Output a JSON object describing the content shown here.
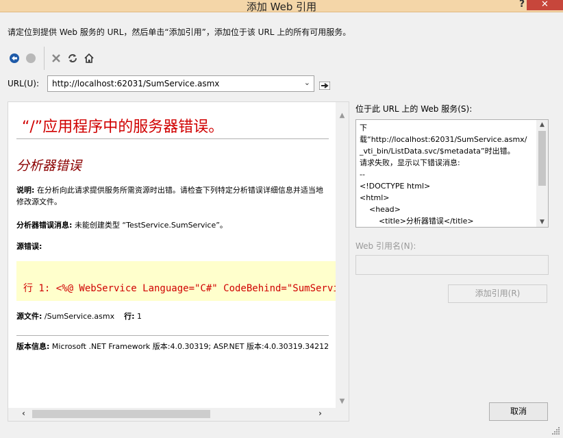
{
  "window": {
    "title": "添加 Web 引用",
    "help": "?",
    "close": "✕"
  },
  "instruction": "请定位到提供 Web 服务的 URL，然后单击“添加引用”，添加位于该 URL 上的所有可用服务。",
  "toolbar": {
    "back_icon": "back-arrow-icon",
    "stop_icon": "stop-icon",
    "delete_icon": "x-icon",
    "refresh_icon": "refresh-icon",
    "home_icon": "home-icon"
  },
  "url": {
    "label": "URL(U):",
    "value": "http://localhost:62031/SumService.asmx",
    "dropdown": "⌄"
  },
  "error_page": {
    "title": "“/”应用程序中的服务器错误。",
    "subtitle": "分析器错误",
    "desc_label": "说明:",
    "desc_text": " 在分析向此请求提供服务所需资源时出错。请检查下列特定分析错误详细信息并适当地修改源文件。",
    "msg_label": "分析器错误消息:",
    "msg_text": " 未能创建类型 “TestService.SumService”。",
    "src_label": "源错误:",
    "code": "行 1:  <%@ WebService Language=\"C#\" CodeBehind=\"SumServic",
    "file_label": "源文件:",
    "file_text": " /SumService.asmx",
    "line_label": "行:",
    "line_text": " 1",
    "version_label": "版本信息:",
    "version_text": " Microsoft .NET Framework 版本:4.0.30319; ASP.NET 版本:4.0.30319.34212"
  },
  "services": {
    "label": "位于此 URL 上的 Web 服务(S):",
    "text": "下\n载“http://localhost:62031/SumService.asmx/\n_vti_bin/ListData.svc/$metadata”时出错。\n请求失败，显示以下错误消息:\n--\n<!DOCTYPE html>\n<html>\n    <head>\n        <title>分析器错误</title>"
  },
  "reference": {
    "label": "Web 引用名(N):",
    "value": ""
  },
  "buttons": {
    "add": "添加引用(R)",
    "cancel": "取消"
  },
  "colors": {
    "titlebar": "#f4d6a8",
    "close": "#c7463b",
    "error_red": "#d00000",
    "code_bg": "#ffffcc"
  }
}
